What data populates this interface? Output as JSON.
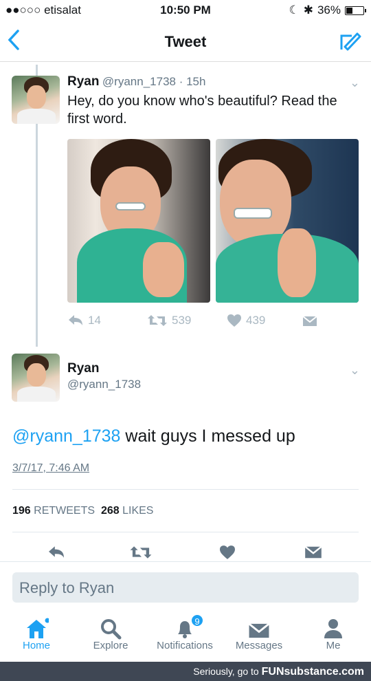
{
  "status_bar": {
    "carrier": "●●○○○ etisalat",
    "time": "10:50 PM",
    "battery": "36%",
    "battery_level": 0.36
  },
  "nav": {
    "title": "Tweet",
    "back_icon": "chevron-left-icon",
    "compose_icon": "compose-icon"
  },
  "first_tweet": {
    "name": "Ryan",
    "handle_time": "@ryann_1738 · 15h",
    "text": "Hey, do you know who's beautiful? Read the first word.",
    "replies": "14",
    "retweets": "539",
    "likes": "439"
  },
  "main_tweet": {
    "name": "Ryan",
    "handle": "@ryann_1738",
    "mention": "@ryann_1738",
    "text": "wait guys I messed up",
    "timestamp": "3/7/17, 7:46 AM",
    "retweet_count": "196",
    "retweet_label": "RETWEETS",
    "like_count": "268",
    "like_label": "LIKES"
  },
  "reply": {
    "placeholder": "Reply to Ryan"
  },
  "tabs": [
    {
      "label": "Home",
      "icon": "home-icon"
    },
    {
      "label": "Explore",
      "icon": "search-icon"
    },
    {
      "label": "Notifications",
      "icon": "bell-icon",
      "badge": "9"
    },
    {
      "label": "Messages",
      "icon": "envelope-icon"
    },
    {
      "label": "Me",
      "icon": "person-icon"
    }
  ],
  "footer": {
    "text": "Seriously, go to",
    "brand": "FUNsubstance.com"
  },
  "colors": {
    "accent": "#1da1f2",
    "muted": "#657786",
    "footer_bg": "#3f4754"
  }
}
